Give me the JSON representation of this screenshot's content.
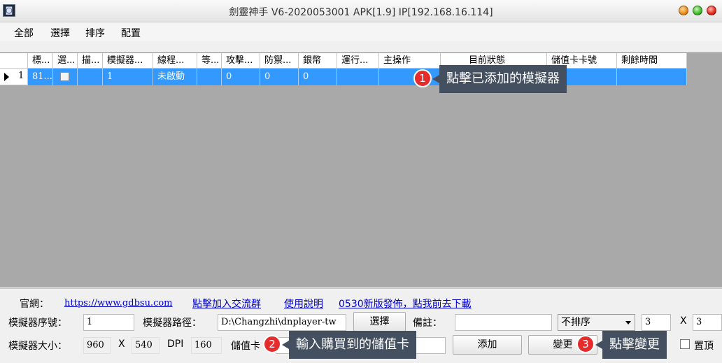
{
  "window": {
    "title": "劍靈神手 V6-2020053001 APK[1.9] IP[192.168.16.114]",
    "icon": "app-icon"
  },
  "menu": [
    "全部",
    "選擇",
    "排序",
    "配置"
  ],
  "grid": {
    "columns": [
      "標...",
      "選...",
      "描...",
      "模擬器...",
      "線程...",
      "等...",
      "攻擊...",
      "防禦...",
      "銀幣",
      "運行...",
      "主操作",
      "目前狀態",
      "儲值卡卡號",
      "剩餘時間"
    ],
    "rows": [
      {
        "num": "1",
        "cells": [
          "81...",
          "",
          "",
          "1",
          "未啟動",
          "",
          "0",
          "0",
          "0",
          "",
          "",
          "",
          "",
          ""
        ]
      }
    ]
  },
  "callouts": [
    {
      "num": "1",
      "text": "點擊已添加的模擬器"
    },
    {
      "num": "2",
      "text": "輸入購買到的儲值卡"
    },
    {
      "num": "3",
      "text": "點擊變更"
    }
  ],
  "bottom": {
    "website_label": "官網：",
    "website_link": "https://www.gdbsu.com",
    "join_link": "點擊加入交流群",
    "help_link": "使用說明",
    "release_link": "0530新版發佈，點我前去下載",
    "emu_index_label": "模擬器序號：",
    "emu_index_value": "1",
    "emu_path_label": "模擬器路徑：",
    "emu_path_value": "D:\\Changzhi\\dnplayer-tw",
    "select_button": "選擇",
    "note_label": "備註：",
    "note_value": "",
    "sort_select": "不排序",
    "grid_x_value": "3",
    "x_label": "X",
    "grid_y_value": "3",
    "emu_size_label": "模擬器大小：",
    "width_value": "960",
    "size_x_label": "X",
    "height_value": "540",
    "dpi_label": "DPI",
    "dpi_value": "160",
    "card_label": "儲值卡",
    "card_value": "",
    "add_button": "添加",
    "change_button": "變更",
    "topmost_label": "置頂"
  }
}
